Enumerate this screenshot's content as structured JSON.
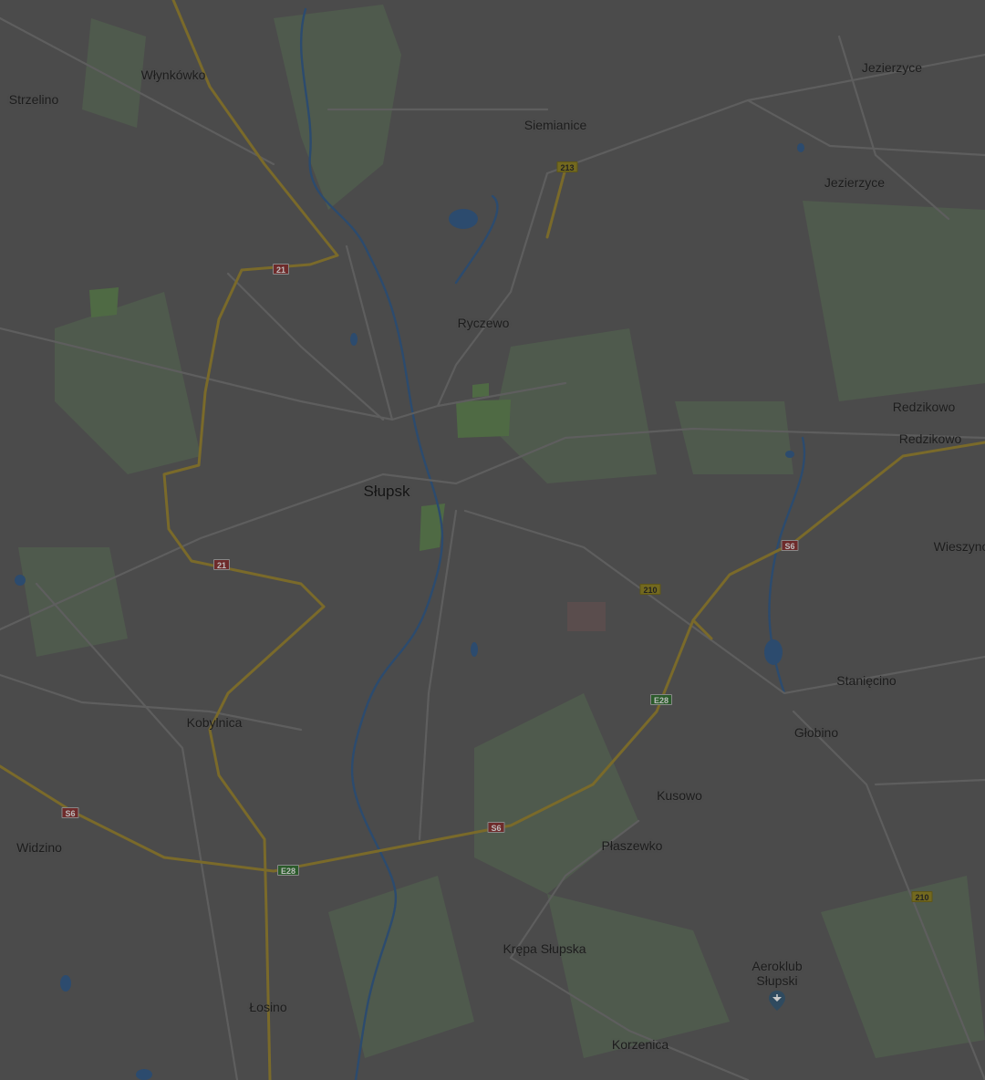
{
  "places": {
    "slupsk": "Słupsk",
    "wlynkowko": "Włynkówko",
    "strzelino": "Strzelino",
    "siemianice": "Siemianice",
    "jezierzyce_n": "Jezierzyce",
    "jezierzyce_s": "Jezierzyce",
    "ryczewo": "Ryczewo",
    "redzikowo_1": "Redzikowo",
    "redzikowo_2": "Redzikowo",
    "wieszyno": "Wieszyno",
    "staniecino": "Stanięcino",
    "globino": "Głobino",
    "kobylnica": "Kobylnica",
    "kusowo": "Kusowo",
    "widzino": "Widzino",
    "plaszewko": "Płaszewko",
    "krepa_slupska": "Krępa Słupska",
    "losino": "Łosino",
    "korzenica": "Korzenica",
    "aeroklub": "Aeroklub\nSłupski"
  },
  "road_shields": {
    "r213": "213",
    "r21_a": "21",
    "r21_b": "21",
    "r210_a": "210",
    "r210_b": "210",
    "s6_a": "S6",
    "s6_b": "S6",
    "s6_c": "S6",
    "e28_a": "E28",
    "e28_b": "E28"
  },
  "icons": {
    "poi": "airfield-pin-icon"
  },
  "colors": {
    "background": "#4b4b4b",
    "major_road": "#7a6a2a",
    "minor_road": "#5f5f5f",
    "water": "#2b4a6b",
    "park": "#4a5a48"
  }
}
